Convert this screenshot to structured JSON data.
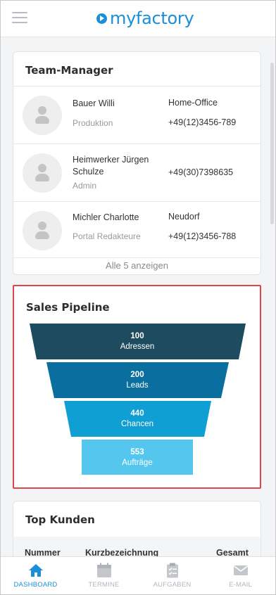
{
  "header": {
    "brand": "myfactory"
  },
  "team_manager": {
    "title": "Team-Manager",
    "members": [
      {
        "name": "Bauer Willi",
        "role": "Produktion",
        "location": "Home-Office",
        "phone": "+49(12)3456-789"
      },
      {
        "name": "Heimwerker Jürgen Schulze",
        "role": "Admin",
        "location": "",
        "phone": "+49(30)7398635"
      },
      {
        "name": "Michler Charlotte",
        "role": "Portal Redakteure",
        "location": "Neudorf",
        "phone": "+49(12)3456-788"
      }
    ],
    "show_all": "Alle 5 anzeigen"
  },
  "sales_pipeline": {
    "title": "Sales Pipeline",
    "stages": [
      {
        "value": "100",
        "label": "Adressen",
        "color": "#1d4b60"
      },
      {
        "value": "200",
        "label": "Leads",
        "color": "#0a6f9e"
      },
      {
        "value": "440",
        "label": "Chancen",
        "color": "#0f9fd3"
      },
      {
        "value": "553",
        "label": "Aufträge",
        "color": "#55c6ee"
      }
    ]
  },
  "top_kunden": {
    "title": "Top Kunden",
    "columns": [
      "Nummer",
      "Kurzbezeichnung",
      "Gesamt"
    ]
  },
  "bottom_nav": {
    "items": [
      {
        "label": "DASHBOARD",
        "icon": "home-icon",
        "active": true
      },
      {
        "label": "TERMINE",
        "icon": "calendar-icon",
        "active": false
      },
      {
        "label": "AUFGABEN",
        "icon": "clipboard-icon",
        "active": false
      },
      {
        "label": "E-MAIL",
        "icon": "mail-icon",
        "active": false
      }
    ],
    "active_color": "#1a8fd6",
    "inactive_color": "#b3b6bb"
  }
}
